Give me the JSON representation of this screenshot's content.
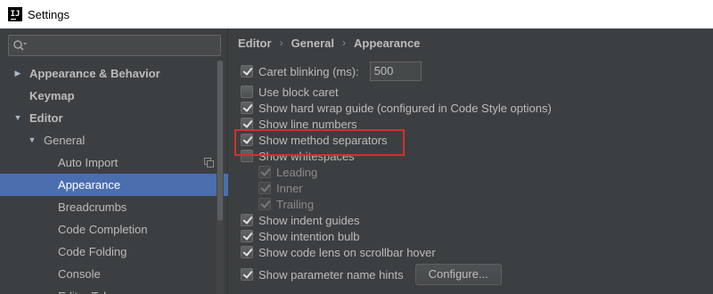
{
  "window": {
    "title": "Settings",
    "icon": "intellij-idea-icon"
  },
  "search": {
    "placeholder": "",
    "icon": "search-icon"
  },
  "tree": [
    {
      "label": "Appearance & Behavior",
      "level": 0,
      "expanded": false,
      "bold": true
    },
    {
      "label": "Keymap",
      "level": 0,
      "bold": true
    },
    {
      "label": "Editor",
      "level": 0,
      "expanded": true,
      "bold": true
    },
    {
      "label": "General",
      "level": 1,
      "expanded": true
    },
    {
      "label": "Auto Import",
      "level": 2,
      "copy_icon": true
    },
    {
      "label": "Appearance",
      "level": 2,
      "selected": true
    },
    {
      "label": "Breadcrumbs",
      "level": 2
    },
    {
      "label": "Code Completion",
      "level": 2
    },
    {
      "label": "Code Folding",
      "level": 2
    },
    {
      "label": "Console",
      "level": 2
    },
    {
      "label": "Editor Tabs",
      "level": 2
    }
  ],
  "breadcrumb": [
    "Editor",
    "General",
    "Appearance"
  ],
  "options": {
    "caret_blinking": {
      "label": "Caret blinking (ms):",
      "checked": true,
      "value": "500"
    },
    "block_caret": {
      "label": "Use block caret",
      "checked": false
    },
    "hard_wrap": {
      "label": "Show hard wrap guide (configured in Code Style options)",
      "checked": true
    },
    "line_numbers": {
      "label": "Show line numbers",
      "checked": true
    },
    "method_separators": {
      "label": "Show method separators",
      "checked": true,
      "highlighted": true
    },
    "whitespaces": {
      "label": "Show whitespaces",
      "checked": false
    },
    "leading": {
      "label": "Leading",
      "checked": true,
      "disabled": true
    },
    "inner": {
      "label": "Inner",
      "checked": true,
      "disabled": true
    },
    "trailing": {
      "label": "Trailing",
      "checked": true,
      "disabled": true
    },
    "indent_guides": {
      "label": "Show indent guides",
      "checked": true
    },
    "intention_bulb": {
      "label": "Show intention bulb",
      "checked": true
    },
    "code_lens": {
      "label": "Show code lens on scrollbar hover",
      "checked": true
    },
    "param_hints": {
      "label": "Show parameter name hints",
      "checked": true,
      "button": "Configure..."
    }
  },
  "colors": {
    "selection": "#4b6eaf",
    "highlight_box": "#d0312d",
    "background": "#3c3f41"
  }
}
